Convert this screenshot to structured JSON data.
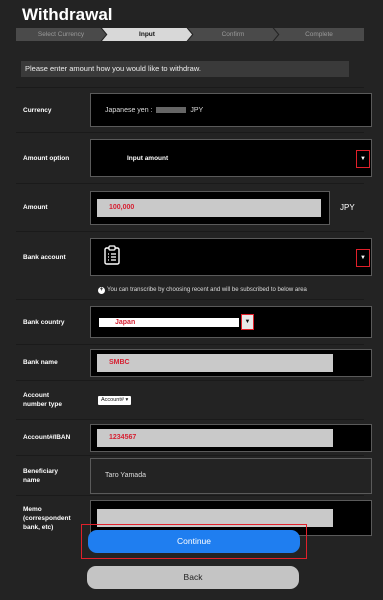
{
  "page": {
    "title": "Withdrawal"
  },
  "steps": [
    {
      "label": "Select Currency",
      "active": false
    },
    {
      "label": "Input",
      "active": true
    },
    {
      "label": "Confirm",
      "active": false
    },
    {
      "label": "Complete",
      "active": false
    }
  ],
  "notice": "Please enter amount how you would like to withdraw.",
  "form": {
    "currency": {
      "label": "Currency",
      "prefix": "Japanese yen :",
      "suffix": "JPY"
    },
    "amount_option": {
      "label": "Amount option",
      "value": "Input amount"
    },
    "amount": {
      "label": "Amount",
      "value": "100,000",
      "unit": "JPY"
    },
    "bank_account": {
      "label": "Bank account"
    },
    "hint": "You can transcribe by choosing recent and will be subscribed to below area",
    "bank_country": {
      "label": "Bank country",
      "value": "Japan"
    },
    "bank_name": {
      "label": "Bank name",
      "value": "SMBC"
    },
    "account_number_type": {
      "label_line1": "Account",
      "label_line2": "number type",
      "value": "Account#"
    },
    "account_iban": {
      "label": "Account#/IBAN",
      "value": "1234567"
    },
    "beneficiary": {
      "label_line1": "Beneficiary",
      "label_line2": "name",
      "value": "Taro Yamada"
    },
    "memo": {
      "label_line1": "Memo",
      "label_line2": "(correspondent",
      "label_line3": "bank, etc)",
      "value": ""
    }
  },
  "buttons": {
    "continue": "Continue",
    "back": "Back"
  },
  "icons": {
    "dropdown": "chevron-down-icon",
    "clipboard": "clipboard-icon",
    "info": "info-icon"
  },
  "colors": {
    "accent": "#1f7ef0",
    "highlight": "#e0202a",
    "value_red": "#d62032"
  }
}
